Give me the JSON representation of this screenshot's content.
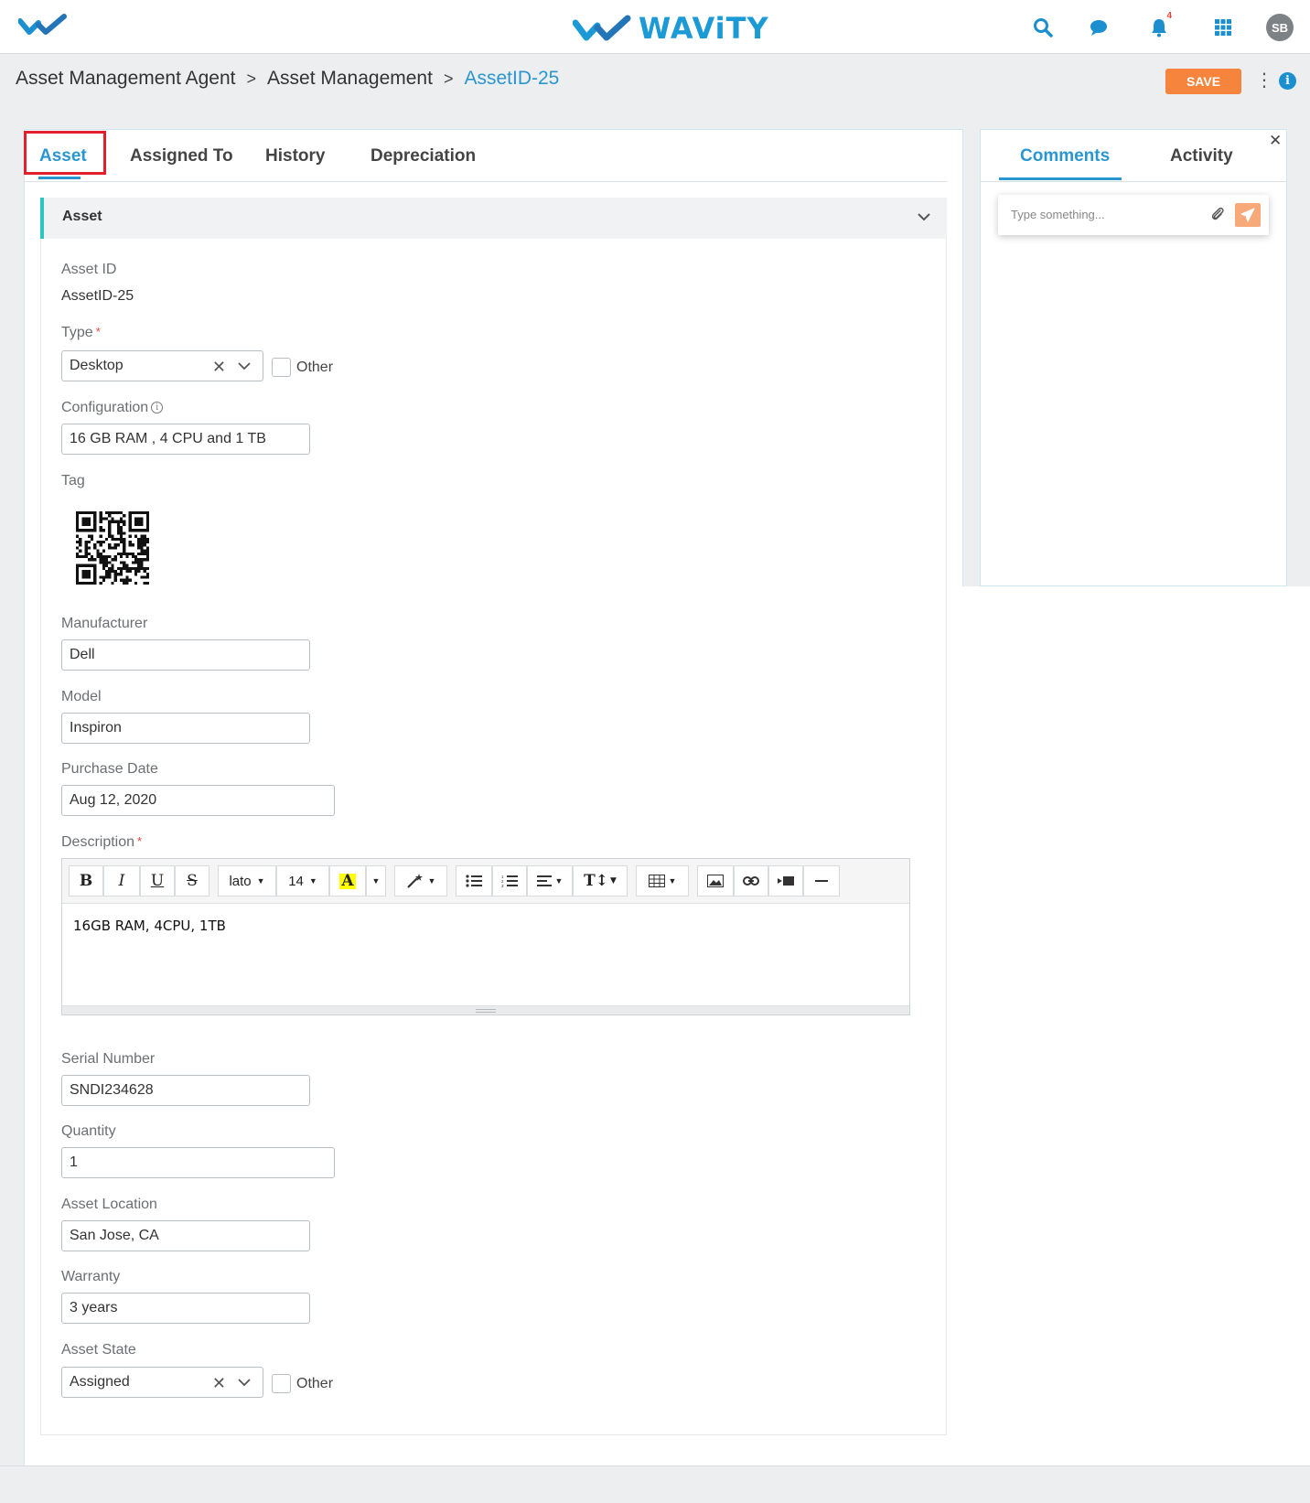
{
  "header": {
    "brand": "WAViTY",
    "notification_count": "4",
    "avatar_initials": "SB"
  },
  "breadcrumb": {
    "items": [
      "Asset Management Agent",
      "Asset Management",
      "AssetID-25"
    ],
    "separator": ">"
  },
  "actions": {
    "save_label": "SAVE"
  },
  "tabs": [
    "Asset",
    "Assigned To",
    "History",
    "Depreciation"
  ],
  "active_tab": "Asset",
  "section": {
    "title": "Asset"
  },
  "form": {
    "asset_id": {
      "label": "Asset ID",
      "value": "AssetID-25"
    },
    "type": {
      "label": "Type",
      "value": "Desktop",
      "other_label": "Other"
    },
    "configuration": {
      "label": "Configuration",
      "value": "16 GB RAM , 4 CPU and 1 TB"
    },
    "tag": {
      "label": "Tag"
    },
    "manufacturer": {
      "label": "Manufacturer",
      "value": "Dell"
    },
    "model": {
      "label": "Model",
      "value": "Inspiron"
    },
    "purchase_date": {
      "label": "Purchase Date",
      "value": "Aug 12, 2020"
    },
    "description": {
      "label": "Description",
      "value": "16GB RAM, 4CPU, 1TB",
      "font": "lato",
      "size": "14"
    },
    "serial_number": {
      "label": "Serial Number",
      "value": "SNDI234628"
    },
    "quantity": {
      "label": "Quantity",
      "value": "1"
    },
    "asset_location": {
      "label": "Asset Location",
      "value": "San Jose, CA"
    },
    "warranty": {
      "label": "Warranty",
      "value": "3 years"
    },
    "asset_state": {
      "label": "Asset State",
      "value": "Assigned",
      "other_label": "Other"
    }
  },
  "side_panel": {
    "tabs": [
      "Comments",
      "Activity"
    ],
    "active_tab": "Comments",
    "comment_placeholder": "Type something..."
  },
  "colors": {
    "accent": "#2a96d0",
    "save": "#f6843c",
    "required": "#e0463a",
    "highlight_box": "#e0202c",
    "section_marker": "#2ec4c0"
  }
}
